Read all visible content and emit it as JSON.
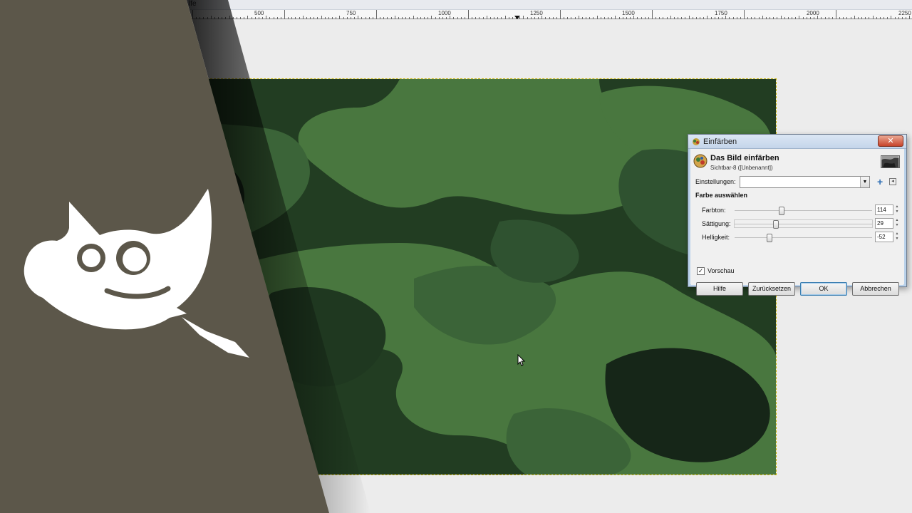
{
  "menubar": {
    "fragment": "lfe"
  },
  "ruler": {
    "labels": [
      "500",
      "750",
      "1000",
      "1250",
      "1500",
      "1750",
      "2000",
      "2250"
    ]
  },
  "dialog": {
    "window_title": "Einfärben",
    "close_label": "✕",
    "header_title": "Das Bild einfärben",
    "header_subtitle": "Sichtbar-8 ([Unbenannt])",
    "settings_label": "Einstellungen:",
    "settings_value": "",
    "section_title": "Farbe auswählen",
    "sliders": [
      {
        "label": "Farbton:",
        "value": "114",
        "fraction": 0.33
      },
      {
        "label": "Sättigung:",
        "value": "29",
        "fraction": 0.29
      },
      {
        "label": "Helligkeit:",
        "value": "-52",
        "fraction": 0.24
      }
    ],
    "preview_label": "Vorschau",
    "preview_checked": true,
    "buttons": {
      "help": "Hilfe",
      "reset": "Zurücksetzen",
      "ok": "OK",
      "cancel": "Abbrechen"
    }
  },
  "colors": {
    "logo_band": "#5c574a",
    "camo_dark": "#223d22",
    "camo_mid": "#2f5230",
    "camo_light": "#49773f",
    "camo_darkest": "#162618"
  },
  "icons": [
    "wilber-logo",
    "mouse-pointer-icon",
    "colorize-icon",
    "add-preset-icon",
    "preset-menu-icon",
    "close-icon"
  ]
}
